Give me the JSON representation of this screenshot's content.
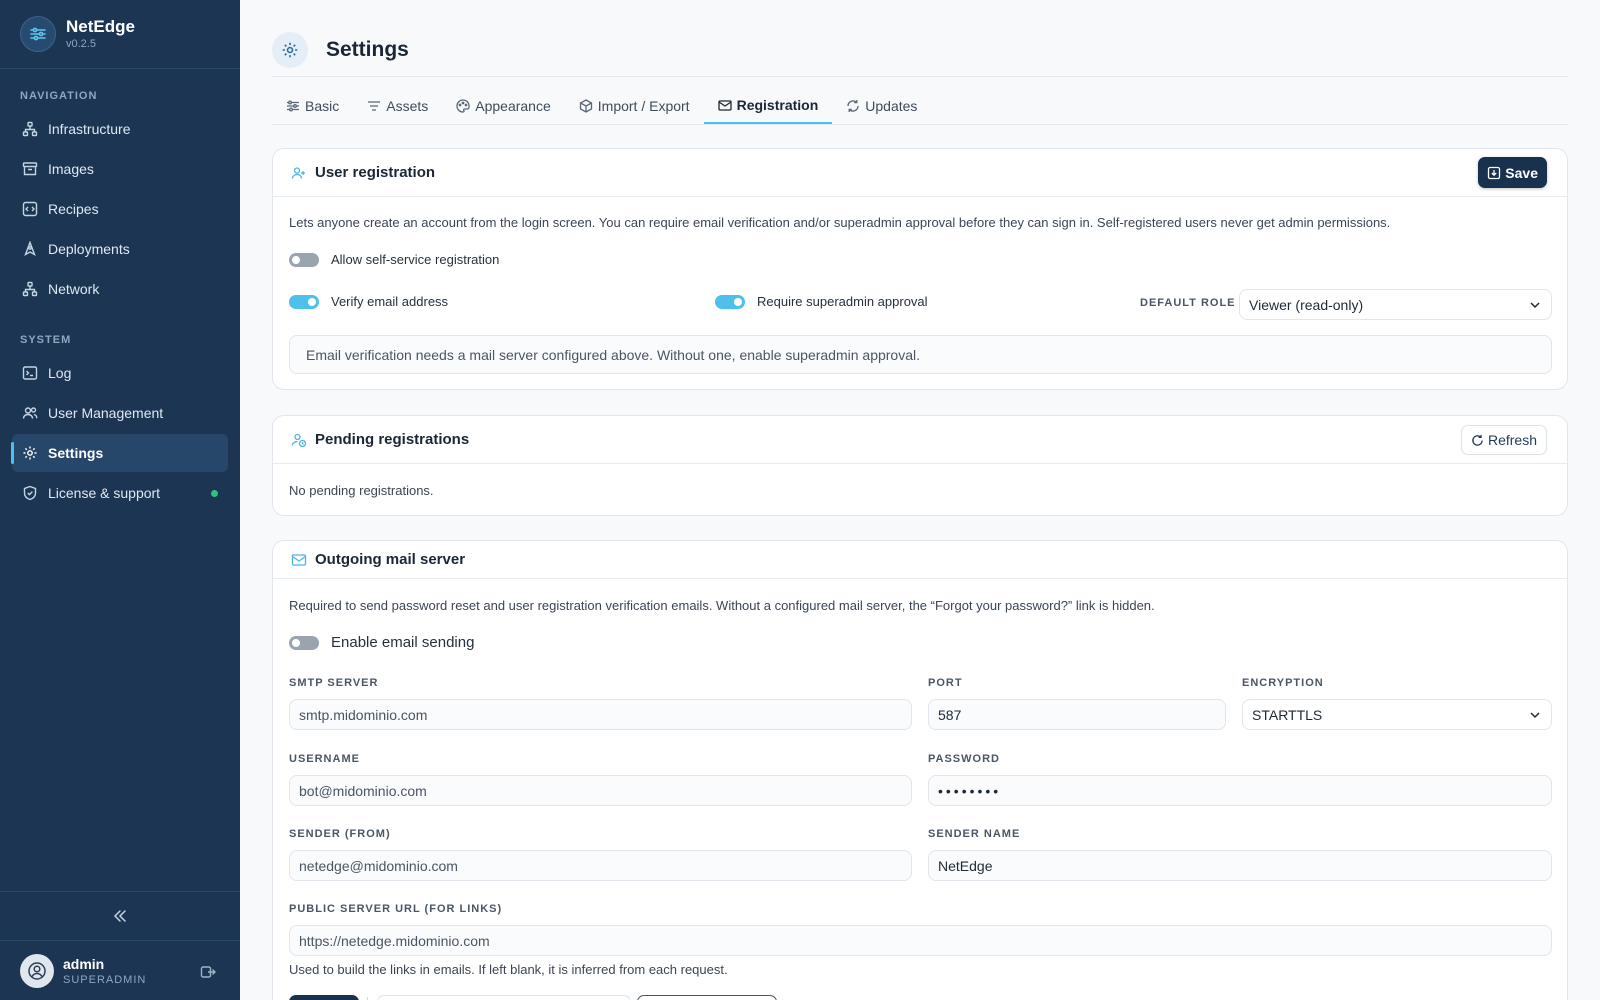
{
  "app": {
    "name": "NetEdge",
    "version": "v0.2.5"
  },
  "sidebar": {
    "sections": [
      {
        "label": "NAVIGATION",
        "items": [
          {
            "label": "Infrastructure",
            "icon": "network-tree-icon"
          },
          {
            "label": "Images",
            "icon": "archive-icon"
          },
          {
            "label": "Recipes",
            "icon": "recipe-code-icon"
          },
          {
            "label": "Deployments",
            "icon": "rocket-icon"
          },
          {
            "label": "Network",
            "icon": "network-icon"
          }
        ]
      },
      {
        "label": "SYSTEM",
        "items": [
          {
            "label": "Log",
            "icon": "terminal-icon"
          },
          {
            "label": "User Management",
            "icon": "users-icon"
          },
          {
            "label": "Settings",
            "icon": "gear-icon",
            "active": true
          },
          {
            "label": "License & support",
            "icon": "shield-icon",
            "status": "online"
          }
        ]
      }
    ],
    "user": {
      "name": "admin",
      "role": "SUPERADMIN"
    }
  },
  "page": {
    "title": "Settings",
    "tabs": [
      {
        "label": "Basic",
        "icon": "sliders-icon"
      },
      {
        "label": "Assets",
        "icon": "assets-icon"
      },
      {
        "label": "Appearance",
        "icon": "palette-icon"
      },
      {
        "label": "Import / Export",
        "icon": "package-icon"
      },
      {
        "label": "Registration",
        "icon": "mail-open-icon",
        "active": true
      },
      {
        "label": "Updates",
        "icon": "refresh-icon"
      }
    ]
  },
  "registration": {
    "title": "User registration",
    "save_label": "Save",
    "description": "Lets anyone create an account from the login screen. You can require email verification and/or superadmin approval before they can sign in. Self-registered users never get admin permissions.",
    "allow_label": "Allow self-service registration",
    "allow_on": false,
    "verify_label": "Verify email address",
    "verify_on": true,
    "approval_label": "Require superadmin approval",
    "approval_on": true,
    "default_role_label": "DEFAULT ROLE",
    "default_role_value": "Viewer (read-only)",
    "note": "Email verification needs a mail server configured above. Without one, enable superadmin approval."
  },
  "pending": {
    "title": "Pending registrations",
    "refresh_label": "Refresh",
    "empty_text": "No pending registrations."
  },
  "mail": {
    "title": "Outgoing mail server",
    "description": "Required to send password reset and user registration verification emails. Without a configured mail server, the “Forgot your password?” link is hidden.",
    "enable_label": "Enable email sending",
    "enable_on": false,
    "smtp_label": "SMTP SERVER",
    "smtp_value": "smtp.midominio.com",
    "port_label": "PORT",
    "port_value": "587",
    "encryption_label": "ENCRYPTION",
    "encryption_value": "STARTTLS",
    "username_label": "USERNAME",
    "username_value": "bot@midominio.com",
    "password_label": "PASSWORD",
    "password_value": "••••••••",
    "sender_label": "SENDER (FROM)",
    "sender_value": "netedge@midominio.com",
    "sender_name_label": "SENDER NAME",
    "sender_name_value": "NetEdge",
    "public_url_label": "PUBLIC SERVER URL (FOR LINKS)",
    "public_url_value": "https://netedge.midominio.com",
    "public_url_help": "Used to build the links in emails. If left blank, it is inferred from each request."
  },
  "colors": {
    "sidebar": "#1c3552",
    "accent": "#4fc0ec",
    "primary_button": "#17314f",
    "status_online": "#2ec27e"
  }
}
